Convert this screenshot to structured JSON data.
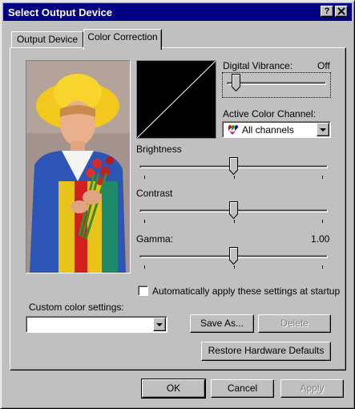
{
  "window": {
    "title": "Select Output Device",
    "help_glyph": "?",
    "close_glyph": "✕"
  },
  "tabs": [
    {
      "label": "Output Device",
      "active": false
    },
    {
      "label": "Color Correction",
      "active": true
    }
  ],
  "color_correction": {
    "digital_vibrance": {
      "label": "Digital Vibrance:",
      "value_text": "Off",
      "value": 0
    },
    "active_channel": {
      "label": "Active Color Channel:",
      "selected": "All channels"
    },
    "brightness": {
      "label": "Brightness",
      "value": 0.5
    },
    "contrast": {
      "label": "Contrast",
      "value": 0.5
    },
    "gamma": {
      "label": "Gamma:",
      "value_text": "1.00",
      "value": 0.5
    },
    "auto_apply": {
      "label": "Automatically apply these settings at startup",
      "checked": false
    },
    "custom_settings": {
      "label": "Custom color settings:",
      "value": ""
    },
    "save_as_label": "Save As...",
    "delete_label": "Delete",
    "restore_label": "Restore Hardware Defaults"
  },
  "footer": {
    "ok_label": "OK",
    "cancel_label": "Cancel",
    "apply_label": "Apply"
  },
  "colors": {
    "title_bar": "#000080",
    "face": "#c0c0c0",
    "disabled_text": "#808080"
  }
}
